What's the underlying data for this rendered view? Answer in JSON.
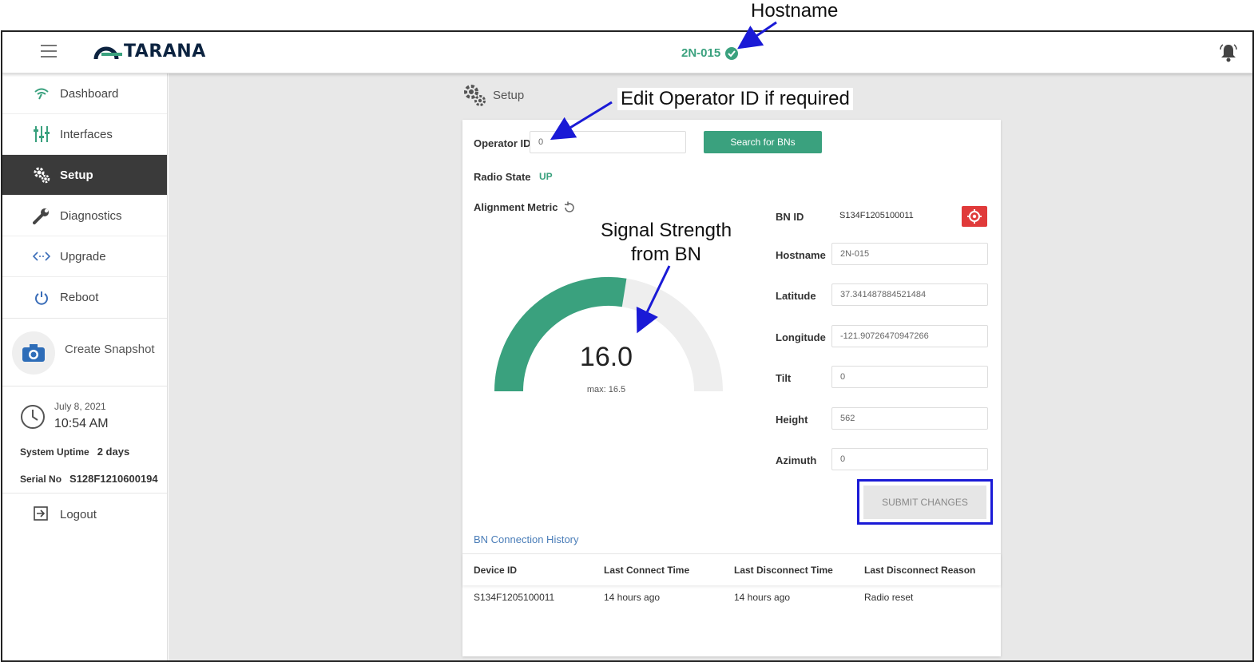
{
  "annotations": {
    "hostname": "Hostname",
    "operator": "Edit Operator ID if required",
    "signal_line1": "Signal Strength",
    "signal_line2": "from BN"
  },
  "topbar": {
    "logo_text": "TARANA",
    "hostname": "2N-015",
    "icons": [
      "hamburger-icon",
      "check-circle-icon",
      "bell-icon"
    ]
  },
  "sidebar": {
    "items": [
      {
        "label": "Dashboard",
        "icon": "wifi-icon"
      },
      {
        "label": "Interfaces",
        "icon": "sliders-icon"
      },
      {
        "label": "Setup",
        "icon": "gears-icon",
        "active": true
      },
      {
        "label": "Diagnostics",
        "icon": "wrench-icon"
      },
      {
        "label": "Upgrade",
        "icon": "code-arrows-icon"
      },
      {
        "label": "Reboot",
        "icon": "power-icon"
      }
    ],
    "snapshot_label": "Create Snapshot",
    "date": "July 8, 2021",
    "time": "10:54 AM",
    "uptime_label": "System Uptime",
    "uptime_value": "2 days",
    "serial_label": "Serial No",
    "serial_value": "S128F1210600194",
    "logout_label": "Logout"
  },
  "main": {
    "page_title": "Setup",
    "operator_label": "Operator ID",
    "operator_value": "0",
    "search_button": "Search for BNs",
    "radio_state_label": "Radio State",
    "radio_state_value": "UP",
    "alignment_label": "Alignment Metric",
    "gauge": {
      "value": "16.0",
      "max_label": "max: 16.5",
      "fraction": 0.55
    },
    "fields": {
      "bn_id_label": "BN ID",
      "bn_id_value": "S134F1205100011",
      "hostname_label": "Hostname",
      "hostname_value": "2N-015",
      "latitude_label": "Latitude",
      "latitude_value": "37.341487884521484",
      "longitude_label": "Longitude",
      "longitude_value": "-121.90726470947266",
      "tilt_label": "Tilt",
      "tilt_value": "0",
      "height_label": "Height",
      "height_value": "562",
      "azimuth_label": "Azimuth",
      "azimuth_value": "0"
    },
    "submit_button": "SUBMIT CHANGES",
    "history": {
      "title": "BN Connection History",
      "columns": [
        "Device ID",
        "Last Connect Time",
        "Last Disconnect Time",
        "Last Disconnect Reason"
      ],
      "rows": [
        [
          "S134F1205100011",
          "14 hours ago",
          "14 hours ago",
          "Radio reset"
        ]
      ]
    }
  },
  "colors": {
    "accent": "#3aa17e",
    "active_nav": "#3a3a3a",
    "alert": "#e03a3a",
    "annotation": "#1a1ad6"
  }
}
